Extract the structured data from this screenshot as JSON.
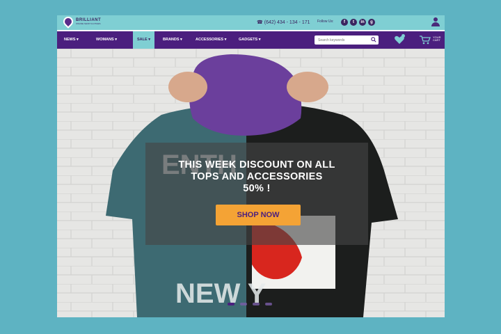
{
  "header": {
    "logo_name": "BRILLIANT",
    "logo_tagline": "ONLINE SHOP CLOTHES",
    "phone": "(642) 434 - 134 - 171",
    "follow_label": "Follow Us:",
    "social": [
      "f",
      "t",
      "in",
      "g"
    ]
  },
  "nav": {
    "items": [
      {
        "label": "NEWS"
      },
      {
        "label": "WOMANS"
      },
      {
        "label": "SALE"
      },
      {
        "label": "BRANDS"
      },
      {
        "label": "ACCESSORIES"
      },
      {
        "label": "GADGETS"
      }
    ],
    "active_index": 2,
    "search_placeholder": "Search keywords",
    "cart_label": "YOUR CART"
  },
  "hero": {
    "headline_line1": "THIS WEEK DISCOUNT ON ALL",
    "headline_line2": "TOPS AND ACCESSORIES",
    "headline_line3": "50% !",
    "cta_label": "SHOP NOW",
    "slides": 4,
    "active_slide": 0
  },
  "colors": {
    "teal": "#7fcfd3",
    "purple": "#4b1f7e",
    "orange": "#f4a335",
    "outer_background": "#5eb3c2"
  }
}
